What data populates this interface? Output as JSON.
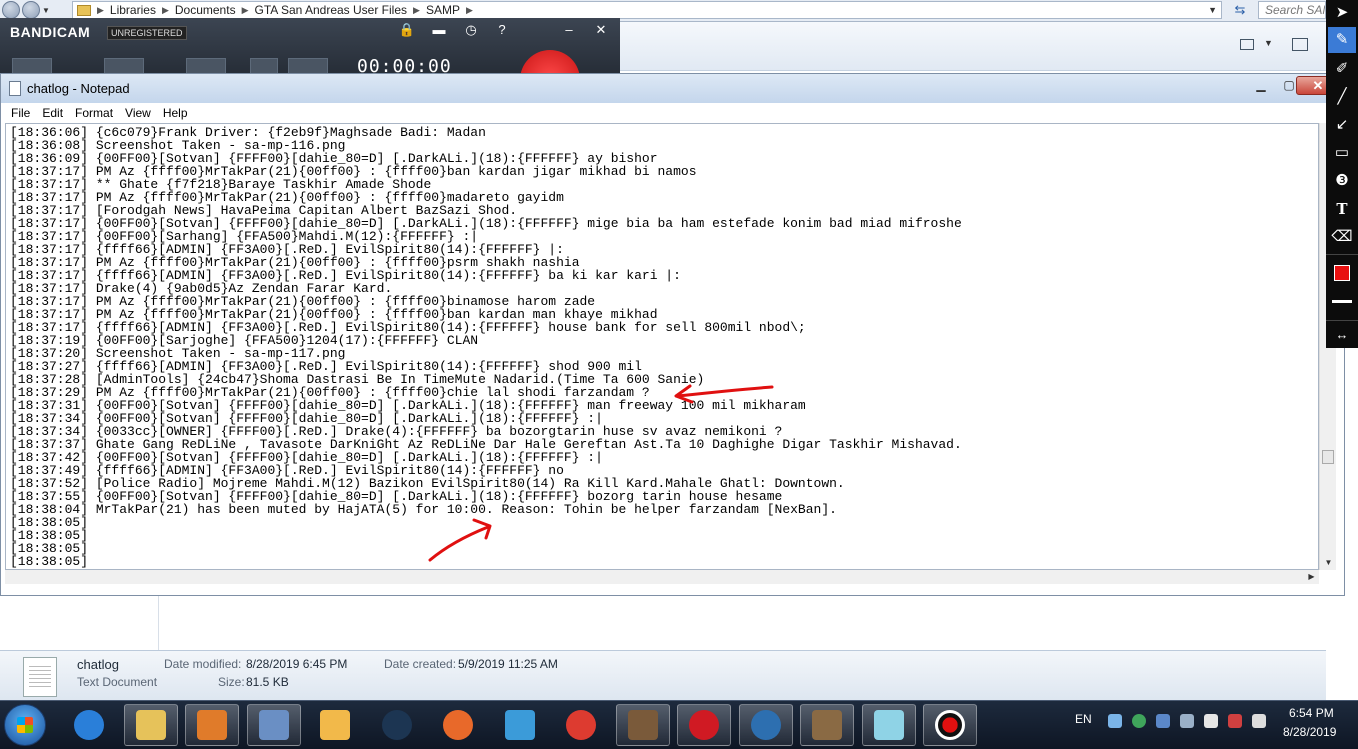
{
  "explorer": {
    "breadcrumb": [
      "Libraries",
      "Documents",
      "GTA San Andreas User Files",
      "SAMP"
    ],
    "search_placeholder": "Search SAMP",
    "details": {
      "file_name": "chatlog",
      "file_type": "Text Document",
      "date_modified_label": "Date modified:",
      "date_modified_value": "8/28/2019 6:45 PM",
      "date_created_label": "Date created:",
      "date_created_value": "5/9/2019 11:25 AM",
      "size_label": "Size:",
      "size_value": "81.5 KB"
    }
  },
  "bandicam": {
    "brand": "BANDICAM",
    "badge": "UNREGISTERED",
    "timer": "00:00:00",
    "help": "?",
    "minimize": "–",
    "close": "✕"
  },
  "notepad": {
    "title": "chatlog - Notepad",
    "menu": [
      "File",
      "Edit",
      "Format",
      "View",
      "Help"
    ],
    "lines": [
      "[18:36:06] {c6c079}Frank Driver: {f2eb9f}Maghsade Badi: Madan",
      "[18:36:08] Screenshot Taken - sa-mp-116.png",
      "[18:36:09] {00FF00}[Sotvan] {FFFF00}[dahie_80=D] [.DarkALi.](18):{FFFFFF} ay bishor",
      "[18:37:17] PM Az {ffff00}MrTakPar(21){00ff00} : {ffff00}ban kardan jigar mikhad bi namos",
      "[18:37:17] ** Ghate {f7f218}Baraye Taskhir Amade Shode",
      "[18:37:17] PM Az {ffff00}MrTakPar(21){00ff00} : {ffff00}madareto gayidm",
      "[18:37:17] [Forodgah News] HavaPeima Capitan Albert BazSazi Shod.",
      "[18:37:17] {00FF00}[Sotvan] {FFFF00}[dahie_80=D] [.DarkALi.](18):{FFFFFF} mige bia ba ham estefade konim bad miad mifroshe",
      "[18:37:17] {00FF00}[Sarhang] {FFA500}Mahdi.M(12):{FFFFFF} :|",
      "[18:37:17] {ffff66}[ADMIN] {FF3A00}[.ReD.] EvilSpirit80(14):{FFFFFF} |:",
      "[18:37:17] PM Az {ffff00}MrTakPar(21){00ff00} : {ffff00}psrm shakh nashia",
      "[18:37:17] {ffff66}[ADMIN] {FF3A00}[.ReD.] EvilSpirit80(14):{FFFFFF} ba ki kar kari |:",
      "[18:37:17] Drake(4) {9ab0d5}Az Zendan Farar Kard.",
      "[18:37:17] PM Az {ffff00}MrTakPar(21){00ff00} : {ffff00}binamose harom zade",
      "[18:37:17] PM Az {ffff00}MrTakPar(21){00ff00} : {ffff00}ban kardan man khaye mikhad",
      "[18:37:17] {ffff66}[ADMIN] {FF3A00}[.ReD.] EvilSpirit80(14):{FFFFFF} house bank for sell 800mil nbod\\;",
      "[18:37:19] {00FF00}[Sarjoghe] {FFA500}1204(17):{FFFFFF} CLAN",
      "[18:37:20] Screenshot Taken - sa-mp-117.png",
      "[18:37:27] {ffff66}[ADMIN] {FF3A00}[.ReD.] EvilSpirit80(14):{FFFFFF} shod 900 mil",
      "[18:37:28] [AdminTools] {24cb47}Shoma Dastrasi Be In TimeMute Nadarid.(Time Ta 600 Sanie)",
      "[18:37:29] PM Az {ffff00}MrTakPar(21){00ff00} : {ffff00}chie lal shodi farzandam ?",
      "[18:37:31] {00FF00}[Sotvan] {FFFF00}[dahie_80=D] [.DarkALi.](18):{FFFFFF} man freeway 100 mil mikharam",
      "[18:37:34] {00FF00}[Sotvan] {FFFF00}[dahie_80=D] [.DarkALi.](18):{FFFFFF} :|",
      "[18:37:34] {0033cc}[OWNER] {FFFF00}[.ReD.] Drake(4):{FFFFFF} ba bozorgtarin huse sv avaz nemikoni ?",
      "[18:37:37] Ghate Gang ReDLiNe , Tavasote DarKniGht Az ReDLiNe Dar Hale Gereftan Ast.Ta 10 Daghighe Digar Taskhir Mishavad.",
      "[18:37:42] {00FF00}[Sotvan] {FFFF00}[dahie_80=D] [.DarkALi.](18):{FFFFFF} :|",
      "[18:37:49] {ffff66}[ADMIN] {FF3A00}[.ReD.] EvilSpirit80(14):{FFFFFF} no",
      "[18:37:52] [Police Radio] Mojreme Mahdi.M(12) Bazikon EvilSpirit80(14) Ra Kill Kard.Mahale Ghatl: Downtown.",
      "[18:37:55] {00FF00}[Sotvan] {FFFF00}[dahie_80=D] [.DarkALi.](18):{FFFFFF} bozorg tarin house hesame",
      "[18:38:04] MrTakPar(21) has been muted by HajATA(5) for 10:00. Reason: Tohin be helper farzandam [NexBan].",
      "[18:38:05]",
      "[18:38:05]",
      "[18:38:05]",
      "[18:38:05]"
    ]
  },
  "annotation_color": "#e01010",
  "palette": {
    "tools": [
      "cursor-icon",
      "pen-icon",
      "highlighter-icon",
      "line-icon",
      "arrow-icon",
      "rectangle-icon",
      "step-icon",
      "text-icon",
      "eraser-icon"
    ],
    "selected_color": "#e81010"
  },
  "taskbar": {
    "apps": [
      "ie-icon",
      "explorer-icon",
      "media-center-icon",
      "network-icon",
      "paint-icon",
      "steam-icon",
      "firefox-icon",
      "box-icon",
      "chrome-icon",
      "gta-icon",
      "opera-icon",
      "support-icon",
      "samp-icon",
      "pen-tool-icon",
      "record-icon"
    ],
    "language": "EN",
    "time": "6:54 PM",
    "date": "8/28/2019"
  }
}
